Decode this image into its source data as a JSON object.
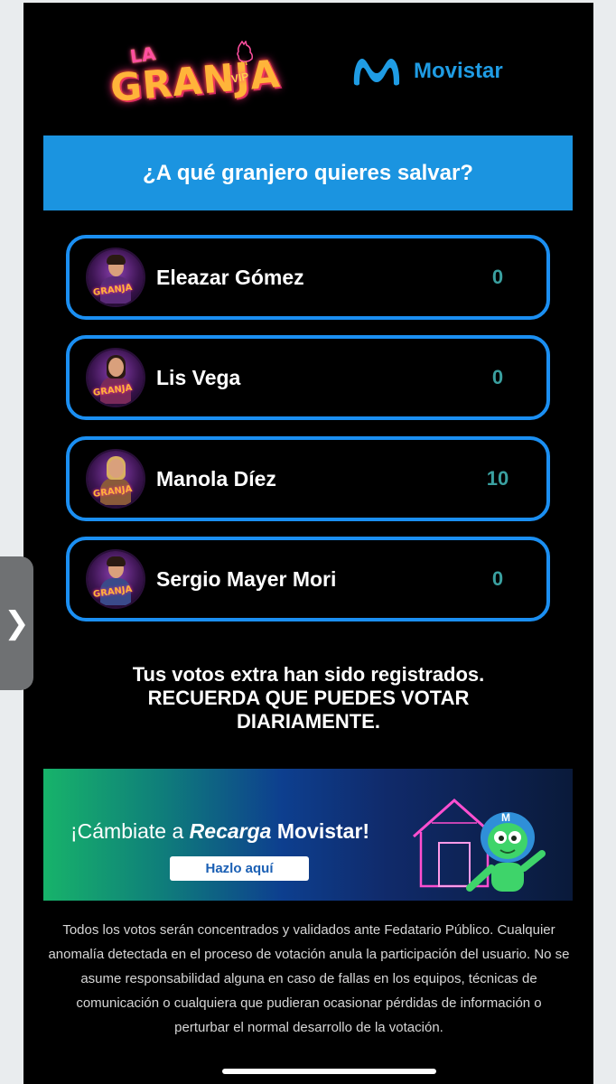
{
  "header": {
    "granja_logo": {
      "la": "LA",
      "main": "GRANJA",
      "vip": "VIP"
    },
    "movistar_logo": {
      "icon": "movistar-m-icon",
      "brand": "Movistar"
    }
  },
  "question": "¿A qué granjero quieres salvar?",
  "contestants": [
    {
      "name": "Eleazar Gómez",
      "votes": "0",
      "avatar_tag": "GRANJA"
    },
    {
      "name": "Lis Vega",
      "votes": "0",
      "avatar_tag": "GRANJA"
    },
    {
      "name": "Manola Díez",
      "votes": "10",
      "avatar_tag": "GRANJA"
    },
    {
      "name": "Sergio Mayer Mori",
      "votes": "0",
      "avatar_tag": "GRANJA"
    }
  ],
  "message": {
    "line1": "Tus votos extra han sido registrados.",
    "line2": "RECUERDA QUE PUEDES VOTAR",
    "line3": "DIARIAMENTE."
  },
  "ad": {
    "prefix": "¡Cámbiate a ",
    "recarga": "Recarga",
    "brand": " Movistar!",
    "button": "Hazlo aquí"
  },
  "disclaimer": {
    "line1": "Todos los votos serán concentrados y validados ante Fedatario Público. Cualquier",
    "line2": "anomalía detectada en el proceso de votación anula la participación del usuario. No se",
    "line3": "asume responsabilidad alguna en caso de fallas en los equipos, técnicas de",
    "line4": "comunicación o cualquiera que pudieran ocasionar pérdidas de información o",
    "line5": "perturbar el normal desarrollo de la votación."
  },
  "side_handle": {
    "icon": "chevron-right-icon",
    "glyph": "❯"
  },
  "colors": {
    "accent": "#1b94e0",
    "card_border": "#1b8ff2",
    "vote_count": "#3aa0a0",
    "background": "#000000"
  }
}
